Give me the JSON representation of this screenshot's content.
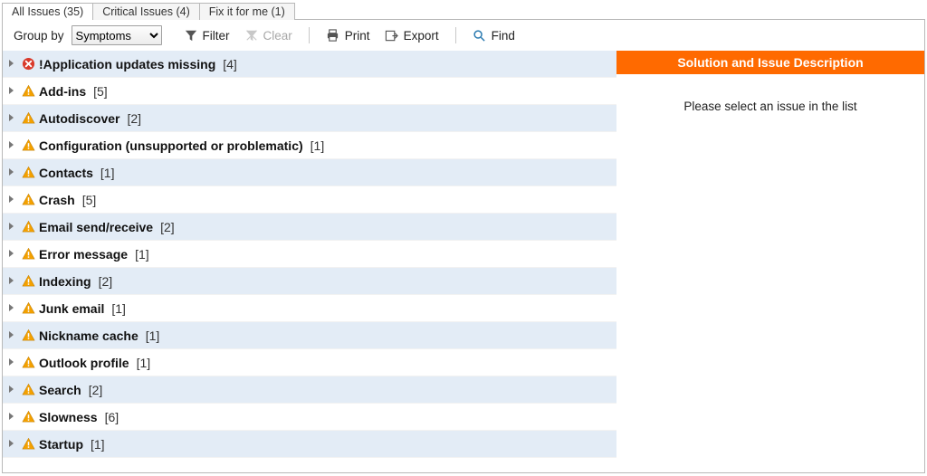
{
  "tabs": [
    {
      "label": "All Issues",
      "count": 35,
      "active": true
    },
    {
      "label": "Critical Issues",
      "count": 4,
      "active": false
    },
    {
      "label": "Fix it for me",
      "count": 1,
      "active": false
    }
  ],
  "toolbar": {
    "group_by_label": "Group by",
    "group_by_value": "Symptoms",
    "filter_label": "Filter",
    "clear_label": "Clear",
    "print_label": "Print",
    "export_label": "Export",
    "find_label": "Find"
  },
  "groups": [
    {
      "icon": "error",
      "label": "!Application updates missing",
      "count": 4
    },
    {
      "icon": "warning",
      "label": "Add-ins",
      "count": 5
    },
    {
      "icon": "warning",
      "label": "Autodiscover",
      "count": 2
    },
    {
      "icon": "warning",
      "label": "Configuration (unsupported or problematic)",
      "count": 1
    },
    {
      "icon": "warning",
      "label": "Contacts",
      "count": 1
    },
    {
      "icon": "warning",
      "label": "Crash",
      "count": 5
    },
    {
      "icon": "warning",
      "label": "Email send/receive",
      "count": 2
    },
    {
      "icon": "warning",
      "label": "Error message",
      "count": 1
    },
    {
      "icon": "warning",
      "label": "Indexing",
      "count": 2
    },
    {
      "icon": "warning",
      "label": "Junk email",
      "count": 1
    },
    {
      "icon": "warning",
      "label": "Nickname cache",
      "count": 1
    },
    {
      "icon": "warning",
      "label": "Outlook profile",
      "count": 1
    },
    {
      "icon": "warning",
      "label": "Search",
      "count": 2
    },
    {
      "icon": "warning",
      "label": "Slowness",
      "count": 6
    },
    {
      "icon": "warning",
      "label": "Startup",
      "count": 1
    }
  ],
  "right_pane": {
    "header": "Solution and Issue Description",
    "placeholder": "Please select an issue in the list"
  }
}
